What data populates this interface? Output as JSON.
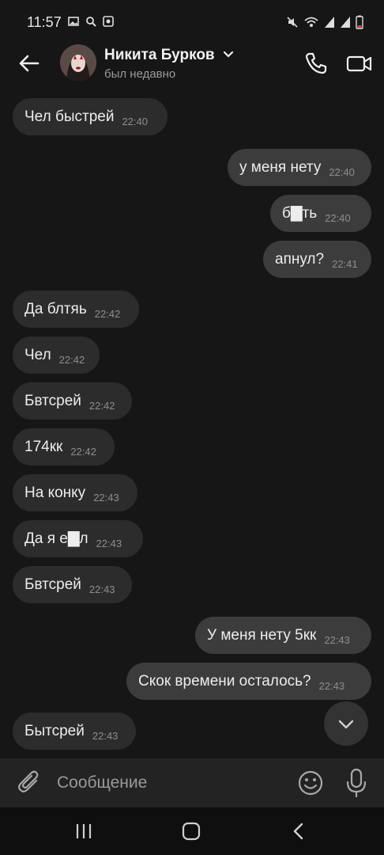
{
  "status_bar": {
    "time": "11:57",
    "left_icons": [
      "image-icon",
      "search-icon",
      "record-icon"
    ],
    "right_icons": [
      "mute-icon",
      "wifi-icon",
      "signal-icon",
      "signal-icon",
      "battery-icon"
    ]
  },
  "header": {
    "contact_name": "Никита Бурков",
    "contact_status": "был недавно"
  },
  "messages": [
    {
      "dir": "in",
      "text": "Чел быстрей",
      "time": "22:40"
    },
    {
      "dir": "out",
      "text": "у меня нету",
      "time": "22:40"
    },
    {
      "dir": "out",
      "text": "б▇ть",
      "time": "22:40"
    },
    {
      "dir": "out",
      "text": "апнул?",
      "time": "22:41"
    },
    {
      "dir": "in",
      "text": "Да блтяь",
      "time": "22:42"
    },
    {
      "dir": "in",
      "text": "Чел",
      "time": "22:42"
    },
    {
      "dir": "in",
      "text": "Бвтсрей",
      "time": "22:42"
    },
    {
      "dir": "in",
      "text": "174кк",
      "time": "22:42"
    },
    {
      "dir": "in",
      "text": "На конку",
      "time": "22:43"
    },
    {
      "dir": "in",
      "text": "Да я е▇л",
      "time": "22:43"
    },
    {
      "dir": "in",
      "text": "Бвтсрей",
      "time": "22:43"
    },
    {
      "dir": "out",
      "text": "У меня нету 5кк",
      "time": "22:43"
    },
    {
      "dir": "out",
      "text": "Скок времени осталось?",
      "time": "22:43"
    },
    {
      "dir": "in",
      "text": "Бытсрей",
      "time": "22:43"
    }
  ],
  "composer": {
    "placeholder": "Сообщение"
  },
  "colors": {
    "background": "#161616",
    "incoming_bubble": "#2c2c2c",
    "outgoing_bubble": "#3c3c3c",
    "composer": "#232323"
  }
}
